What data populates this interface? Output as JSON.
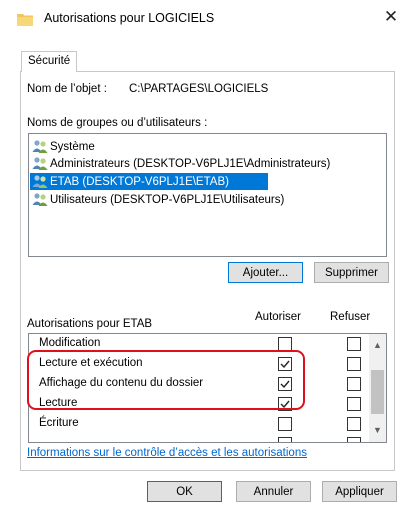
{
  "window": {
    "title": "Autorisations pour LOGICIELS",
    "close_symbol": "✕"
  },
  "tab": {
    "label": "Sécurité"
  },
  "object": {
    "label": "Nom de l’objet :",
    "value": "C:\\PARTAGES\\LOGICIELS"
  },
  "groups": {
    "label": "Noms de groupes ou d’utilisateurs :",
    "items": [
      {
        "label": "Système",
        "icon": "users-icon",
        "selected": false
      },
      {
        "label": "Administrateurs (DESKTOP-V6PLJ1E\\Administrateurs)",
        "icon": "users-icon",
        "selected": false
      },
      {
        "label": "ETAB (DESKTOP-V6PLJ1E\\ETAB)",
        "icon": "users-icon",
        "selected": true
      },
      {
        "label": "Utilisateurs (DESKTOP-V6PLJ1E\\Utilisateurs)",
        "icon": "users-icon",
        "selected": false
      }
    ]
  },
  "buttons": {
    "add": "Ajouter...",
    "remove": "Supprimer",
    "ok": "OK",
    "cancel": "Annuler",
    "apply": "Appliquer"
  },
  "permissions": {
    "label": "Autorisations pour ETAB",
    "col_allow": "Autoriser",
    "col_deny": "Refuser",
    "rows": [
      {
        "name": "Modification",
        "allow": false,
        "deny": false
      },
      {
        "name": "Lecture et exécution",
        "allow": true,
        "deny": false
      },
      {
        "name": "Affichage du contenu du dossier",
        "allow": true,
        "deny": false
      },
      {
        "name": "Lecture",
        "allow": true,
        "deny": false
      },
      {
        "name": "Écriture",
        "allow": false,
        "deny": false
      }
    ]
  },
  "link": {
    "label": "Informations sur le contrôle d’accès et les autorisations"
  },
  "colors": {
    "selection": "#0078d7",
    "highlight": "#e0101a",
    "link": "#0066cc",
    "focus": "#0078d7"
  }
}
